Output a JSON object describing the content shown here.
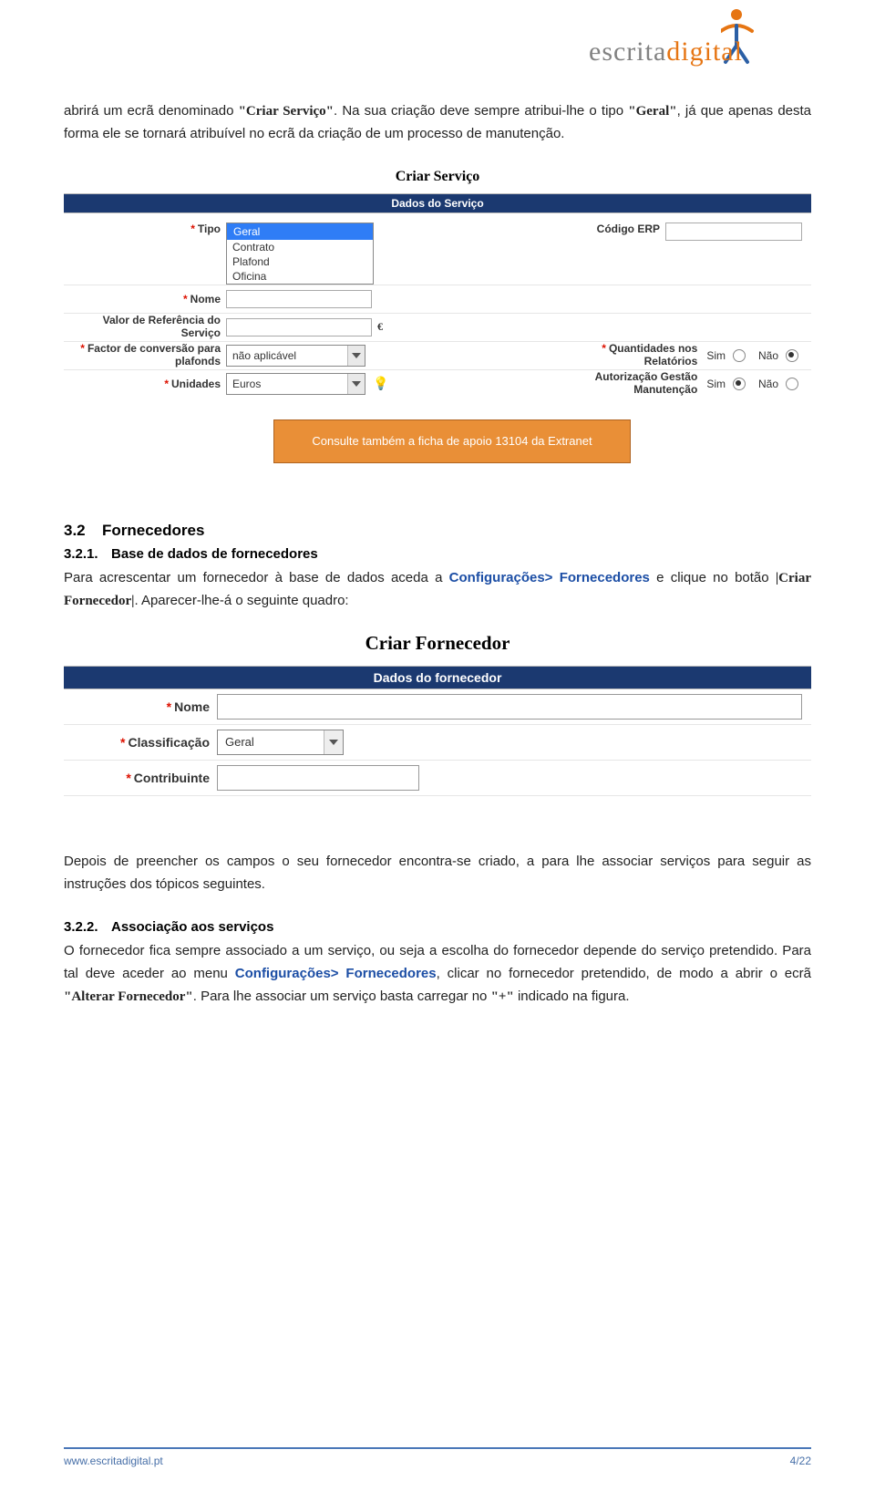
{
  "logo": {
    "word": "escrita",
    "accent": "digital"
  },
  "intro": {
    "p1a": "abrirá um ecrã denominado ",
    "p1b": "\"Criar Serviço\"",
    "p1c": ". Na sua criação deve sempre atribui-lhe o tipo ",
    "p1d": "\"Geral\"",
    "p1e": ", já que apenas desta forma ele se tornará atribuível no ecrã da criação de um processo de manutenção."
  },
  "ss1": {
    "title": "Criar Serviço",
    "header": "Dados do Serviço",
    "labels": {
      "tipo": "Tipo",
      "nome": "Nome",
      "valorRef": "Valor de Referência do Serviço",
      "factor": "Factor de conversão para plafonds",
      "unidades": "Unidades",
      "codigoErp": "Código ERP",
      "quantRel": "Quantidades nos Relatórios",
      "autGestao": "Autorização Gestão Manutenção"
    },
    "tipoOptions": [
      "Geral",
      "Contrato",
      "Plafond",
      "Oficina"
    ],
    "euro": "€",
    "factorVal": "não aplicável",
    "unidadesVal": "Euros",
    "sim": "Sim",
    "nao": "Não"
  },
  "callout": {
    "text": "Consulte também a ficha de apoio 13104 da Extranet"
  },
  "sec32": {
    "num": "3.2",
    "title": "Fornecedores"
  },
  "sec321": {
    "num": "3.2.1.",
    "title": "Base de dados de fornecedores",
    "p1a": "Para acrescentar um fornecedor à base de dados aceda a ",
    "p1b": "Configurações> Fornecedores",
    "p1c": " e clique no botão ",
    "p1d": "|Criar Fornecedor|",
    "p1e": ". Aparecer-lhe-á o seguinte quadro:"
  },
  "ss2": {
    "title": "Criar Fornecedor",
    "header": "Dados do fornecedor",
    "labels": {
      "nome": "Nome",
      "classificacao": "Classificação",
      "contribuinte": "Contribuinte"
    },
    "classVal": "Geral"
  },
  "para2": {
    "text": "Depois de preencher os campos o seu fornecedor encontra-se criado, a para lhe associar serviços para seguir as instruções dos tópicos seguintes."
  },
  "sec322": {
    "num": "3.2.2.",
    "title": "Associação aos serviços",
    "p1a": "O fornecedor fica sempre associado a um serviço, ou seja a escolha do fornecedor depende do serviço pretendido. Para tal deve aceder ao menu ",
    "p1b": "Configurações> Fornecedores",
    "p1c": ", clicar no fornecedor pretendido, de modo a abrir o ecrã ",
    "p1d": "\"Alterar Fornecedor\"",
    "p1e": ". Para lhe associar um serviço basta carregar no ",
    "p1f": "\"+\"",
    "p1g": " indicado na figura."
  },
  "footer": {
    "url": "www.escritadigital.pt",
    "page": "4/22"
  }
}
